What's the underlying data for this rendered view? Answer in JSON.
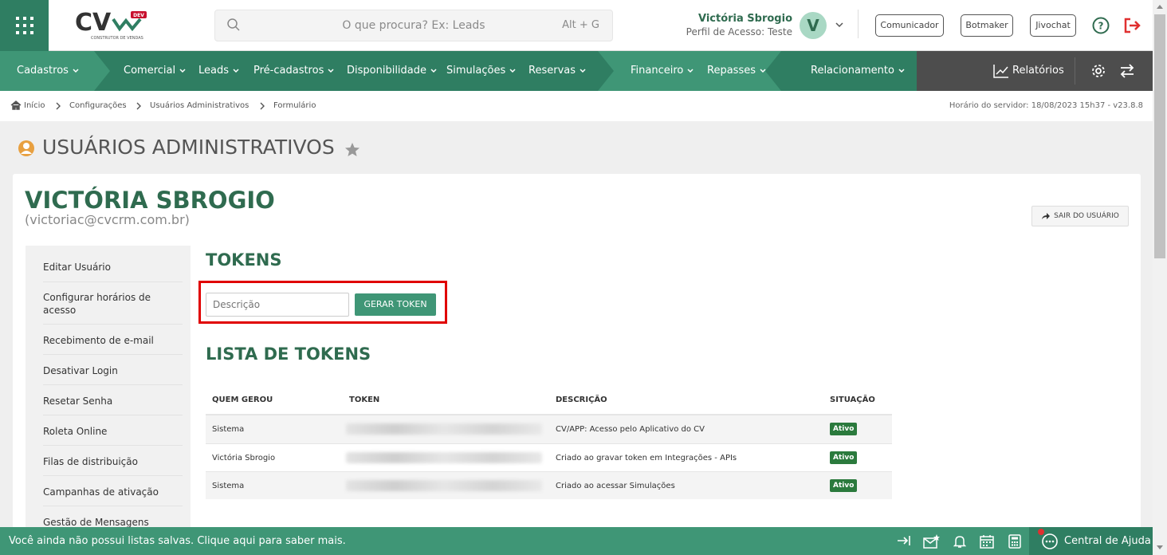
{
  "header": {
    "logo_text": "CV",
    "logo_badge": "DEV",
    "logo_subtitle": "CONSTRUTOR DE VENDAS",
    "search_placeholder": "O que procura? Ex: Leads",
    "search_shortcut": "Alt + G",
    "user_name": "Victória Sbrogio",
    "user_profile": "Perfil de Acesso: Teste",
    "avatar_letter": "V",
    "buttons": [
      "Comunicador",
      "Botmaker",
      "Jivochat"
    ]
  },
  "nav": {
    "items": [
      "Cadastros",
      "Comercial",
      "Leads",
      "Pré-cadastros",
      "Disponibilidade",
      "Simulações",
      "Reservas",
      "Financeiro",
      "Repasses",
      "Relacionamento"
    ],
    "reports": "Relatórios"
  },
  "breadcrumb": {
    "items": [
      "Início",
      "Configurações",
      "Usuários Administrativos",
      "Formulário"
    ],
    "server_time": "Horário do servidor: 18/08/2023 15h37 - v23.8.8"
  },
  "page": {
    "title": "USUÁRIOS ADMINISTRATIVOS"
  },
  "profile": {
    "name": "VICTÓRIA SBROGIO",
    "email": "(victoriac@cvcrm.com.br)",
    "logout_user": "SAIR DO USUÁRIO"
  },
  "sidebar": {
    "items": [
      "Editar Usuário",
      "Configurar horários de acesso",
      "Recebimento de e-mail",
      "Desativar Login",
      "Resetar Senha",
      "Roleta Online",
      "Filas de distribuição",
      "Campanhas de ativação",
      "Gestão de Mensagens"
    ]
  },
  "tokens": {
    "heading": "TOKENS",
    "description_placeholder": "Descrição",
    "generate_button": "GERAR TOKEN",
    "list_heading": "LISTA DE TOKENS",
    "columns": [
      "QUEM GEROU",
      "TOKEN",
      "DESCRIÇÃO",
      "SITUAÇÃO"
    ],
    "rows": [
      {
        "who": "Sistema",
        "description": "CV/APP: Acesso pelo Aplicativo do CV",
        "status": "Ativo"
      },
      {
        "who": "Victória Sbrogio",
        "description": "Criado ao gravar token em Integrações - APIs",
        "status": "Ativo"
      },
      {
        "who": "Sistema",
        "description": "Criado ao acessar Simulações",
        "status": "Ativo"
      }
    ]
  },
  "footer": {
    "message": "Você ainda não possui listas salvas. Clique aqui para saber mais.",
    "help_center": "Central de Ajuda"
  },
  "colors": {
    "primary": "#2f7e62",
    "nav_dark": "#4d4d4d",
    "heading": "#2f6b4f",
    "highlight": "#e00000",
    "footer": "#3f9676"
  }
}
